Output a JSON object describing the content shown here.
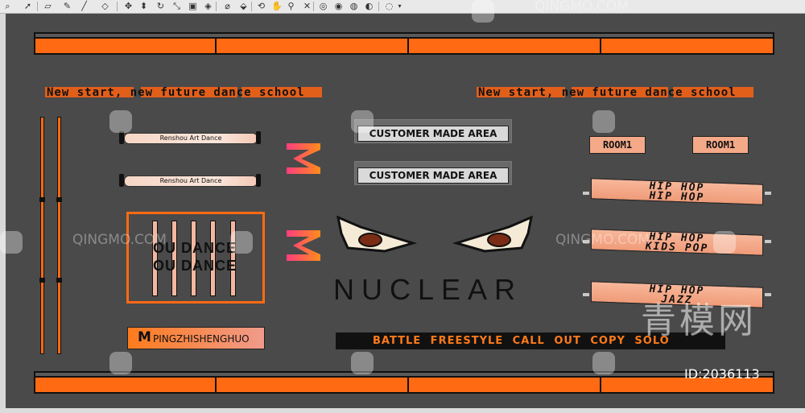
{
  "toolbar": {
    "tools": [
      "select-icon",
      "eraser-icon",
      "pencil-icon",
      "line-icon",
      "shape-icon",
      "move-icon",
      "push-pull-icon",
      "rotate-icon",
      "scale-icon",
      "offset-icon",
      "tape-icon",
      "paint-icon",
      "text-icon",
      "orbit-icon",
      "pan-icon",
      "zoom-icon",
      "zoom-extents-icon",
      "section-icon",
      "section-display-icon",
      "section-fill-icon",
      "look-around-icon"
    ]
  },
  "scene": {
    "slogan_left": "New start, new future dance school",
    "slogan_right": "New start, new future dance school",
    "tube_top_label": "Renshou Art Dance",
    "tube_bottom_label": "Renshou Art Dance",
    "custom_area_1": "CUSTOMER MADE AREA",
    "custom_area_2": "CUSTOMER MADE AREA",
    "room_1": "ROOM1",
    "room_2": "ROOM1",
    "prism_1_line1": "HIP HOP",
    "prism_1_line2": "HIP HOP",
    "prism_2_line1": "HIP HOP",
    "prism_2_line2": "KIDS POP",
    "prism_3_line1": "HIP HOP",
    "prism_3_line2": "JAZZ",
    "frame_line1": "OU DANCE",
    "frame_line2": "OU DANCE",
    "sign_letter": "M",
    "sign_text": "PINGZHISHENGHUO",
    "nuclear": "NUCLEAR",
    "battle_text": "BATTLE  FREESTYLE CALL OUT   COPY   SOLO",
    "m_logo_top": "M",
    "m_logo_bottom": "M"
  },
  "watermark": {
    "text": "QINGMO.COM",
    "id": "ID:2036113",
    "brand_cn": "青模网"
  },
  "colors": {
    "orange": "#ff6a13",
    "canvas": "#4a4a4a",
    "salmon": "#f4a988"
  }
}
